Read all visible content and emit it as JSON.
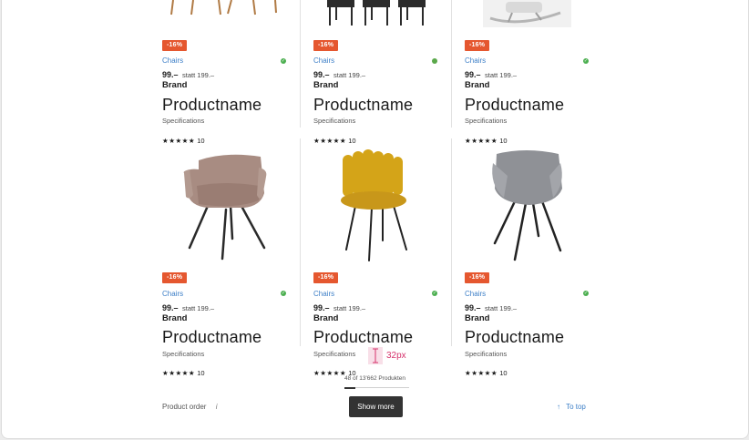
{
  "products": [
    {
      "discount": "-16%",
      "category": "Chairs",
      "price": "99.–",
      "old_price": "statt 199.–",
      "brand": "Brand",
      "name": "Productname",
      "specs": "Specifications",
      "stars": "★★★★★",
      "rating_count": "10",
      "thumb_icon": "wooden-chair-legs"
    },
    {
      "discount": "-16%",
      "category": "Chairs",
      "price": "99.–",
      "old_price": "statt 199.–",
      "brand": "Brand",
      "name": "Productname",
      "specs": "Specifications",
      "stars": "★★★★★",
      "rating_count": "10",
      "thumb_icon": "black-chairs-set"
    },
    {
      "discount": "-16%",
      "category": "Chairs",
      "price": "99.–",
      "old_price": "statt 199.–",
      "brand": "Brand",
      "name": "Productname",
      "specs": "Specifications",
      "stars": "★★★★★",
      "rating_count": "10",
      "thumb_icon": "rocking-chair"
    },
    {
      "discount": "-16%",
      "category": "Chairs",
      "price": "99.–",
      "old_price": "statt 199.–",
      "brand": "Brand",
      "name": "Productname",
      "specs": "Specifications",
      "stars": "★★★★★",
      "rating_count": "10",
      "thumb_icon": "taupe-armchair"
    },
    {
      "discount": "-16%",
      "category": "Chairs",
      "price": "99.–",
      "old_price": "statt 199.–",
      "brand": "Brand",
      "name": "Productname",
      "specs": "Specifications",
      "stars": "★★★★★",
      "rating_count": "10",
      "thumb_icon": "mustard-velvet-chair"
    },
    {
      "discount": "-16%",
      "category": "Chairs",
      "price": "99.–",
      "old_price": "statt 199.–",
      "brand": "Brand",
      "name": "Productname",
      "specs": "Specifications",
      "stars": "★★★★★",
      "rating_count": "10",
      "thumb_icon": "grey-shell-chair"
    }
  ],
  "footer": {
    "product_order_label": "Product order",
    "info_icon": "i",
    "count_text": "48 of 13'662  Produkten",
    "progress_fraction": 0.17,
    "show_more_label": "Show more",
    "to_top_label": "To top",
    "to_top_icon": "↑"
  },
  "annotation": {
    "measure_label": "32px"
  },
  "colors": {
    "badge": "#e5572f",
    "link": "#3d7fc7",
    "status": "#4caf50",
    "button": "#333333",
    "annotation": "#d6336c"
  }
}
